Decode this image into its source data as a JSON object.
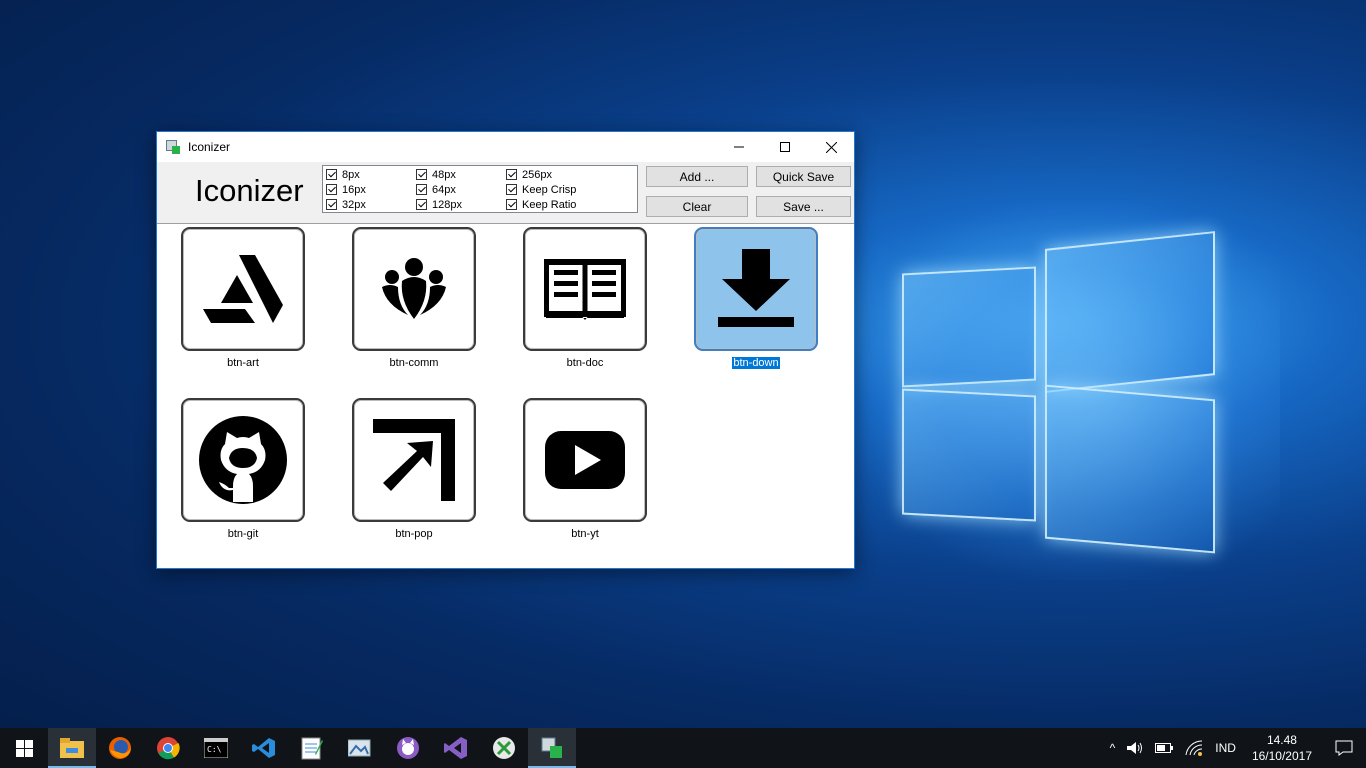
{
  "window": {
    "title": "Iconizer",
    "controls": {
      "minimize": "—",
      "maximize": "☐",
      "close": "✕"
    }
  },
  "toolbar": {
    "heading": "Iconizer",
    "options": [
      {
        "label": "8px",
        "checked": true
      },
      {
        "label": "16px",
        "checked": true
      },
      {
        "label": "32px",
        "checked": true
      },
      {
        "label": "48px",
        "checked": true
      },
      {
        "label": "64px",
        "checked": true
      },
      {
        "label": "128px",
        "checked": true
      },
      {
        "label": "256px",
        "checked": true
      },
      {
        "label": "Keep Crisp",
        "checked": true
      },
      {
        "label": "Keep Ratio",
        "checked": true
      }
    ],
    "buttons": {
      "add": "Add ...",
      "quick_save": "Quick Save",
      "clear": "Clear",
      "save": "Save ..."
    }
  },
  "icons": [
    {
      "label": "btn-art",
      "icon": "artstation-icon",
      "selected": false
    },
    {
      "label": "btn-comm",
      "icon": "community-icon",
      "selected": false
    },
    {
      "label": "btn-doc",
      "icon": "book-icon",
      "selected": false
    },
    {
      "label": "btn-down",
      "icon": "download-icon",
      "selected": true
    },
    {
      "label": "btn-git",
      "icon": "github-icon",
      "selected": false
    },
    {
      "label": "btn-pop",
      "icon": "popout-arrow-icon",
      "selected": false
    },
    {
      "label": "btn-yt",
      "icon": "youtube-icon",
      "selected": false
    }
  ],
  "taskbar": {
    "apps": [
      "start-icon",
      "file-explorer-icon",
      "firefox-icon",
      "chrome-icon",
      "terminal-icon",
      "vscode-icon",
      "notepad-icon",
      "photo-icon",
      "github-desktop-icon",
      "visual-studio-icon",
      "remote-icon",
      "iconizer-icon"
    ],
    "tray": {
      "chevron": "^",
      "language": "IND",
      "time": "14.48",
      "date": "16/10/2017"
    }
  },
  "colors": {
    "accent": "#0078d7",
    "selected_tile": "#8ec4ec",
    "taskbar": "#101418"
  }
}
